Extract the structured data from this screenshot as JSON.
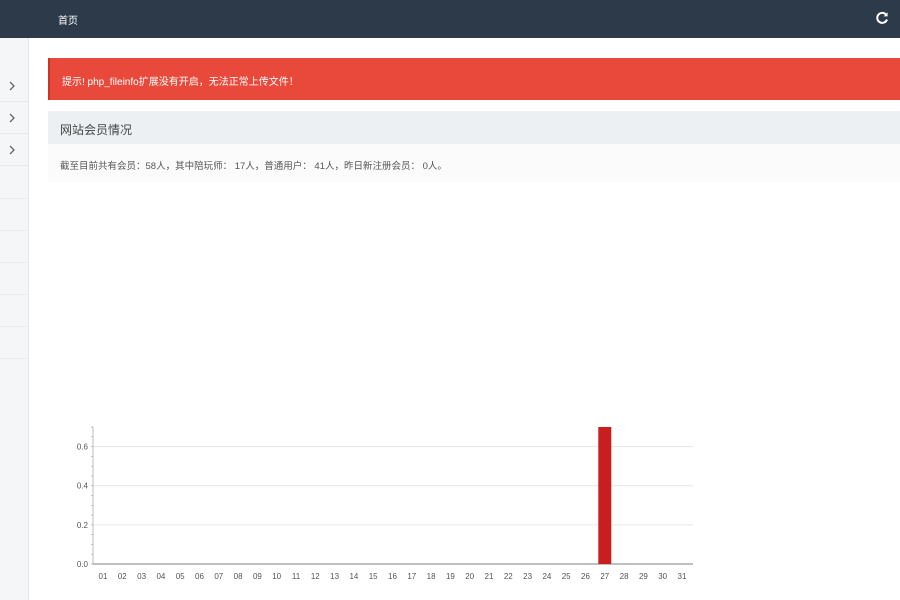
{
  "header": {
    "home_label": "首页",
    "refresh_icon": "refresh-icon",
    "bg_color": "#2c3a4a"
  },
  "sidebar": {
    "items": [
      {
        "icon": "chevron-right-icon"
      },
      {
        "icon": "chevron-right-icon"
      },
      {
        "icon": "chevron-right-icon"
      }
    ]
  },
  "alert": {
    "text": "提示! php_fileinfo扩展没有开启，无法正常上传文件！",
    "color": "#e8493a"
  },
  "panel": {
    "title": "网站会员情况",
    "stats_text": "截至目前共有会员：58人，其中陪玩师： 17人，普通用户： 41人，昨日新注册会员： 0人。"
  },
  "chart_data": {
    "type": "bar",
    "categories": [
      "01",
      "02",
      "03",
      "04",
      "05",
      "06",
      "07",
      "08",
      "09",
      "10",
      "11",
      "12",
      "13",
      "14",
      "15",
      "16",
      "17",
      "18",
      "19",
      "20",
      "21",
      "22",
      "23",
      "24",
      "25",
      "26",
      "27",
      "28",
      "29",
      "30",
      "31"
    ],
    "values": [
      0,
      0,
      0,
      0,
      0,
      0,
      0,
      0,
      0,
      0,
      0,
      0,
      0,
      0,
      0,
      0,
      0,
      0,
      0,
      0,
      0,
      0,
      0,
      0,
      0,
      0,
      0.7,
      0,
      0,
      0,
      0
    ],
    "yticks": [
      "0.0",
      "0.2",
      "0.4",
      "0.6"
    ],
    "ylim": [
      0,
      0.7
    ],
    "grid": true,
    "bar_color": "#c81e1e"
  }
}
